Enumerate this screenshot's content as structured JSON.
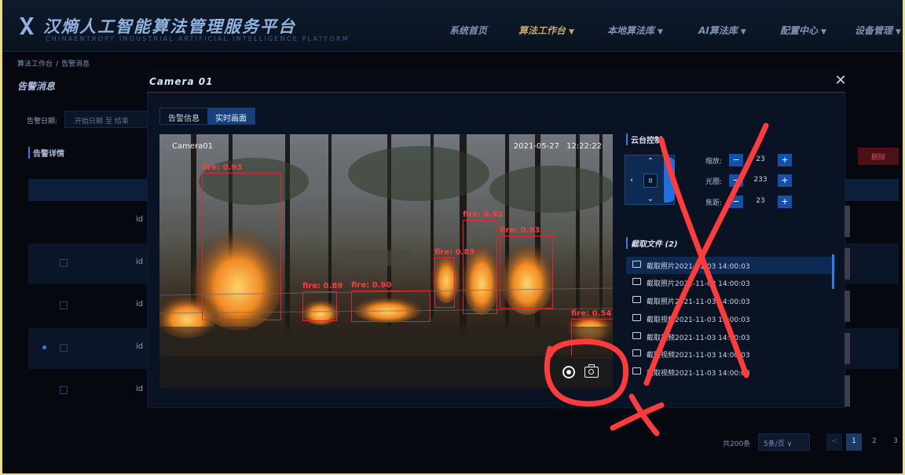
{
  "header": {
    "title": "汉熵人工智能算法管理服务平台",
    "subtitle": "CHINAENTROPY INDUSTRIAL ARTIFICIAL INTELLIGENCE PLATFORM",
    "nav": [
      {
        "label": "系统首页",
        "caret": ""
      },
      {
        "label": "算法工作台",
        "caret": "▼"
      },
      {
        "label": "本地算法库",
        "caret": "▼"
      },
      {
        "label": "AI算法库",
        "caret": "▼"
      },
      {
        "label": "配置中心",
        "caret": "▼"
      },
      {
        "label": "设备管理",
        "caret": "▼"
      }
    ]
  },
  "page": {
    "breadcrumb": [
      "算法工作台",
      "告警消息"
    ],
    "title": "告警消息",
    "filter_label": "告警日期:",
    "date_range": "开始日期  至  结束",
    "section_title": "告警详情",
    "delete_label": "删除",
    "row_cells": [
      "id",
      "id",
      "id",
      "id",
      "id"
    ],
    "pager": {
      "total": "共200条",
      "page_size": "5条/页  ∨",
      "prev": "<",
      "pages": [
        "1",
        "2",
        "3"
      ]
    }
  },
  "modal": {
    "title": "Camera 01",
    "close": "✕",
    "tabs": [
      "告警信息",
      "实时画面"
    ],
    "active_tab": "实时画面",
    "video": {
      "camera_label": "Camera01",
      "timestamp": "2021-05-27  12:22:22",
      "detections": [
        {
          "label": "fire: 0.93"
        },
        {
          "label": "fire: 0.89"
        },
        {
          "label": "fire: 0.90"
        },
        {
          "label": "fire: 0.89"
        },
        {
          "label": "fire: 0.92"
        },
        {
          "label": "fire: 0.93"
        },
        {
          "label": "fire: 0.54"
        }
      ],
      "controls": {
        "record_icon": "record-icon",
        "snapshot_icon": "camera-icon"
      }
    },
    "ptz": {
      "title": "云台控制",
      "pad": {
        "up": "⌃",
        "down": "⌄",
        "left": "‹",
        "center": "II"
      },
      "controls": [
        {
          "label": "缩放:",
          "value": "23",
          "minus": "−",
          "plus": "+"
        },
        {
          "label": "光圈:",
          "value": "233",
          "minus": "−",
          "plus": "+"
        },
        {
          "label": "焦距:",
          "value": "23",
          "minus": "−",
          "plus": "+"
        }
      ]
    },
    "captures": {
      "title": "截取文件 (2)",
      "items": [
        {
          "type": "image",
          "text": "截取照片2021-11-03  14:00:03"
        },
        {
          "type": "image",
          "text": "截取照片2021-11-03  14:00:03"
        },
        {
          "type": "image",
          "text": "截取照片2021-11-03  14:00:03"
        },
        {
          "type": "video",
          "text": "截取视频2021-11-03  14:00:03"
        },
        {
          "type": "video",
          "text": "截取视频2021-11-03  14:00:03"
        },
        {
          "type": "video",
          "text": "截取视频2021-11-03  14:00:03"
        },
        {
          "type": "video",
          "text": "截取视频2021-11-03  14:00:03"
        }
      ]
    }
  },
  "colors": {
    "annotation": "#ff3b3b",
    "accent": "#1450a8",
    "fire_box": "#e2262a"
  }
}
